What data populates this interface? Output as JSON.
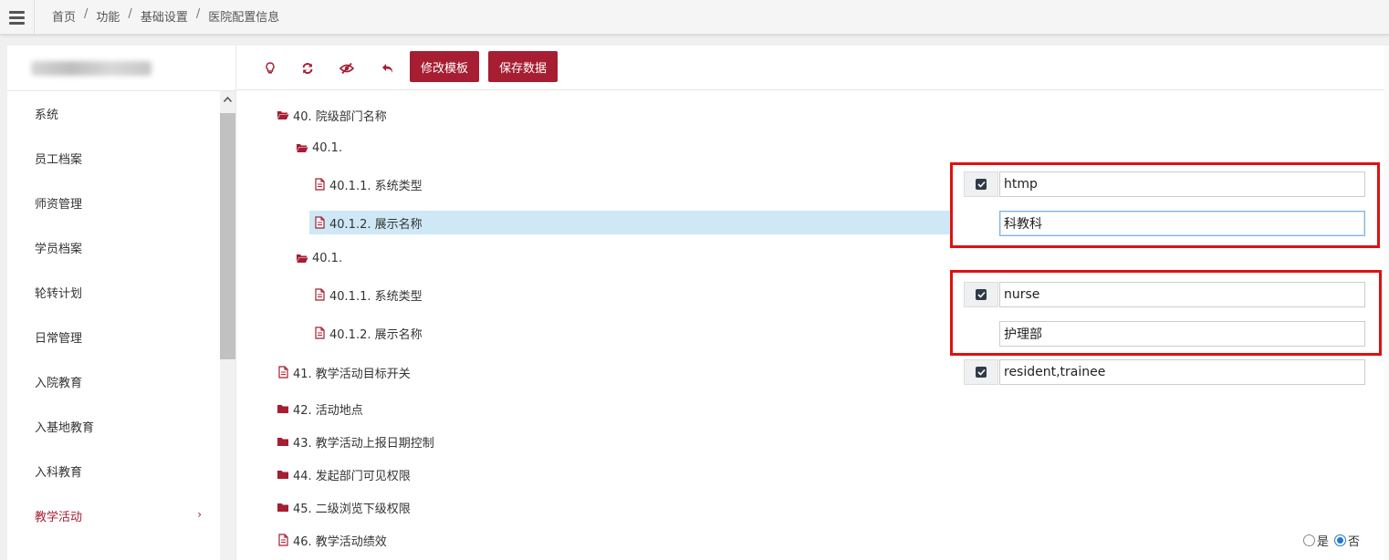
{
  "breadcrumb": {
    "home": "首页",
    "func": "功能",
    "basic": "基础设置",
    "current": "医院配置信息",
    "sep": "/"
  },
  "sidebar": {
    "items": [
      {
        "label": "系统"
      },
      {
        "label": "员工档案"
      },
      {
        "label": "师资管理"
      },
      {
        "label": "学员档案"
      },
      {
        "label": "轮转计划"
      },
      {
        "label": "日常管理"
      },
      {
        "label": "入院教育"
      },
      {
        "label": "入基地教育"
      },
      {
        "label": "入科教育"
      },
      {
        "label": "教学活动",
        "active": true
      }
    ]
  },
  "toolbar": {
    "edit_template": "修改模板",
    "save_data": "保存数据",
    "icons": [
      "lightbulb-icon",
      "refresh-icon",
      "eye-slash-icon",
      "undo-icon"
    ]
  },
  "tree": {
    "n40": "40. 院级部门名称",
    "n40_1a": "40.1.",
    "n40_1a_1": "40.1.1. 系统类型",
    "n40_1a_2": "40.1.2. 展示名称",
    "n40_1b": "40.1.",
    "n40_1b_1": "40.1.1. 系统类型",
    "n40_1b_2": "40.1.2. 展示名称",
    "n41": "41. 教学活动目标开关",
    "n42": "42. 活动地点",
    "n43": "43. 教学活动上报日期控制",
    "n44": "44. 发起部门可见权限",
    "n45": "45. 二级浏览下级权限",
    "n46": "46. 教学活动绩效"
  },
  "fields": {
    "sys_type_a": "htmp",
    "display_a": "科教科",
    "sys_type_b": "nurse",
    "display_b": "护理部",
    "target_switch": "resident,trainee"
  },
  "radio": {
    "yes": "是",
    "no": "否",
    "selected": "否"
  },
  "colors": {
    "accent": "#a71d31",
    "highlight_box": "#e01010",
    "selected_row": "#cfe8f6"
  }
}
